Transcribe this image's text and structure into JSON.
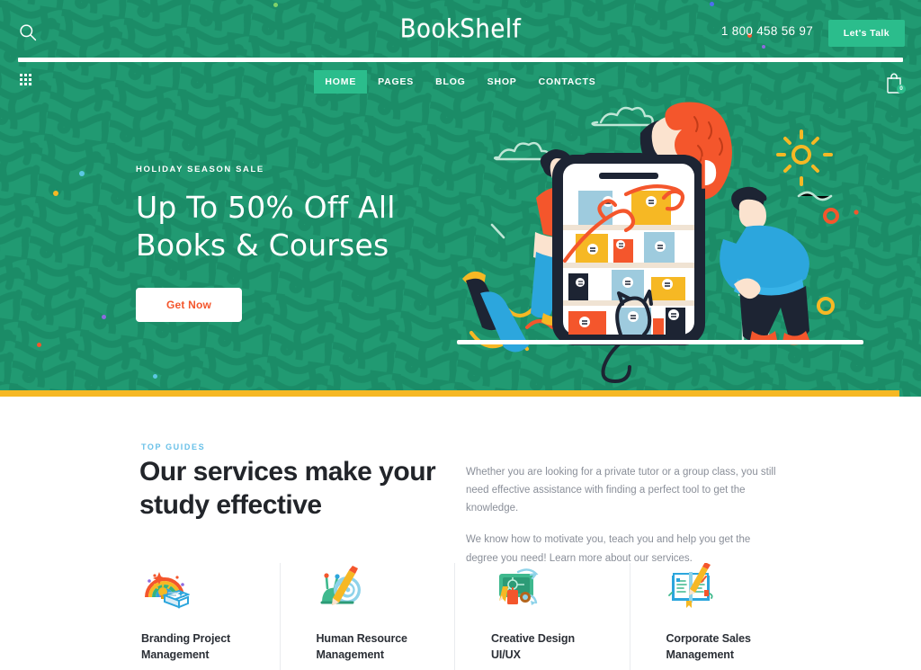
{
  "site": {
    "logo": "BookShelf",
    "accent_green": "#219a72",
    "accent_teal": "#2bbd8c",
    "accent_orange": "#f4562c",
    "accent_yellow": "#f6b824",
    "accent_blue": "#68c0e8"
  },
  "topbar": {
    "search_icon": "search-icon",
    "phone": "1 800 458 56 97",
    "cta_label": "Let's Talk",
    "grid_icon": "grid-dots-icon",
    "cart_icon": "shopping-bag-icon",
    "cart_count": "0"
  },
  "nav": {
    "items": [
      {
        "label": "HOME",
        "active": true
      },
      {
        "label": "PAGES",
        "active": false
      },
      {
        "label": "BLOG",
        "active": false
      },
      {
        "label": "SHOP",
        "active": false
      },
      {
        "label": "CONTACTS",
        "active": false
      }
    ]
  },
  "hero": {
    "eyebrow": "HOLIDAY SEASON SALE",
    "title": "Up To 50% Off All\nBooks & Courses",
    "button_label": "Get Now",
    "illustration": "people-browsing-bookshelf-illustration"
  },
  "services": {
    "eyebrow": "TOP GUIDES",
    "title": "Our services make your\nstudy effective",
    "paragraphs": [
      "Whether you are looking for a private tutor or a group class, you still need effective assistance with finding a perfect tool to get the knowledge.",
      "We know how to motivate you, teach you and help you get the degree you need! Learn more about our services."
    ],
    "cards": [
      {
        "label": "Branding Project\nManagement",
        "icon": "rainbow-book-icon"
      },
      {
        "label": "Human Resource\nManagement",
        "icon": "snail-pencil-icon"
      },
      {
        "label": "Creative Design\nUI/UX",
        "icon": "chalkboard-design-icon"
      },
      {
        "label": "Corporate Sales\nManagement",
        "icon": "open-book-pencil-icon"
      }
    ]
  }
}
